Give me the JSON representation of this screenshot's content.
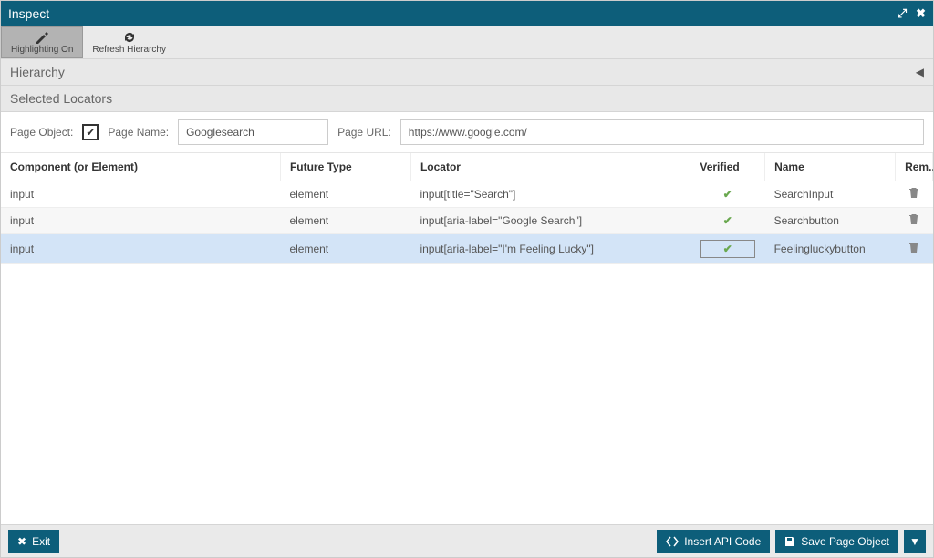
{
  "titlebar": {
    "title": "Inspect"
  },
  "toolbar": {
    "highlighting_label": "Highlighting On",
    "refresh_label": "Refresh Hierarchy"
  },
  "panels": {
    "hierarchy": "Hierarchy",
    "selected_locators": "Selected Locators"
  },
  "form": {
    "page_object_label": "Page Object:",
    "page_name_label": "Page Name:",
    "page_name_value": "Googlesearch",
    "page_url_label": "Page URL:",
    "page_url_value": "https://www.google.com/"
  },
  "table": {
    "headers": {
      "component": "Component (or Element)",
      "future_type": "Future Type",
      "locator": "Locator",
      "verified": "Verified",
      "name": "Name",
      "remove": "Rem..."
    },
    "rows": [
      {
        "component": "input",
        "future_type": "element",
        "locator": "input[title=\"Search\"]",
        "verified": true,
        "name": "SearchInput",
        "selected": false
      },
      {
        "component": "input",
        "future_type": "element",
        "locator": "input[aria-label=\"Google Search\"]",
        "verified": true,
        "name": "Searchbutton",
        "selected": false
      },
      {
        "component": "input",
        "future_type": "element",
        "locator": "input[aria-label=\"I'm Feeling Lucky\"]",
        "verified": true,
        "name": "Feelingluckybutton",
        "selected": true
      }
    ]
  },
  "footer": {
    "exit": "Exit",
    "insert_api": "Insert API Code",
    "save": "Save Page Object"
  },
  "icons": {
    "check": "✔",
    "expand": "⤢",
    "close": "✖",
    "caret_left": "◀",
    "caret_down": "▼"
  }
}
